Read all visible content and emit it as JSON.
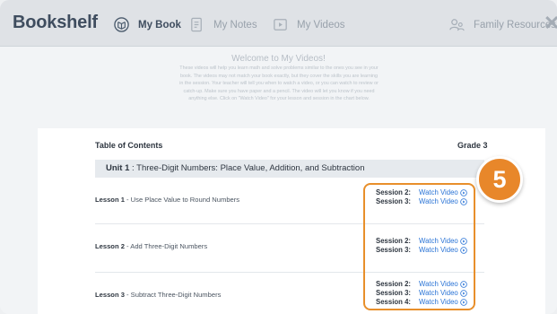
{
  "nav": {
    "brand": "Bookshelf",
    "items": [
      {
        "label": "My Book",
        "icon": "book-icon",
        "active": true
      },
      {
        "label": "My Notes",
        "icon": "notes-icon",
        "active": false
      },
      {
        "label": "My Videos",
        "icon": "video-icon",
        "active": false
      },
      {
        "label": "Family Resources",
        "icon": "family-icon",
        "active": false
      }
    ],
    "close_icon": "close-icon"
  },
  "intro": {
    "title": "Welcome to My Videos!",
    "body": "These videos will help you learn math and solve problems similar to the ones you see in your book. The videos may not match your book exactly, but they cover the skills you are learning in the session. Your teacher will tell you when to watch a video, or you can watch to review or catch-up. Make sure you have paper and a pencil. The video will let you know if you need anything else. Click on \"Watch Video\" for your lesson and session in the chart below."
  },
  "toc": {
    "title": "Table of Contents",
    "grade": "Grade 3",
    "unit": {
      "label": "Unit 1",
      "title": " : Three-Digit Numbers: Place Value, Addition, and Subtraction"
    },
    "lessons": [
      {
        "label": "Lesson 1",
        "title": " - Use Place Value to Round Numbers",
        "sessions": [
          {
            "label": "Session 2:",
            "link": "Watch Video"
          },
          {
            "label": "Session 3:",
            "link": "Watch Video"
          }
        ]
      },
      {
        "label": "Lesson 2",
        "title": " - Add Three-Digit Numbers",
        "sessions": [
          {
            "label": "Session 2:",
            "link": "Watch Video"
          },
          {
            "label": "Session 3:",
            "link": "Watch Video"
          }
        ]
      },
      {
        "label": "Lesson 3",
        "title": " - Subtract Three-Digit Numbers",
        "sessions": [
          {
            "label": "Session 2:",
            "link": "Watch Video"
          },
          {
            "label": "Session 3:",
            "link": "Watch Video"
          },
          {
            "label": "Session 4:",
            "link": "Watch Video"
          }
        ]
      }
    ]
  },
  "callout": {
    "number": "5"
  },
  "colors": {
    "accent": "#e8872a",
    "link": "#2a74d6",
    "brand": "#3f4d5f"
  }
}
